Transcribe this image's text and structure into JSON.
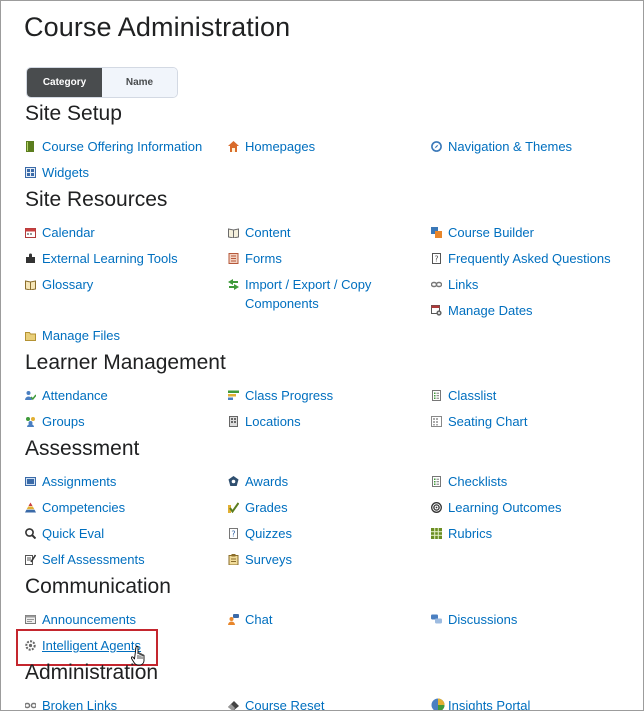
{
  "page": {
    "title": "Course Administration"
  },
  "view_toggle": {
    "category_label": "Category",
    "name_label": "Name",
    "selected": "Category"
  },
  "sections": [
    {
      "heading": "Site Setup",
      "tools": [
        {
          "label": "Course Offering Information",
          "icon": "book-icon"
        },
        {
          "label": "Homepages",
          "icon": "home-icon"
        },
        {
          "label": "Navigation & Themes",
          "icon": "compass-icon"
        },
        {
          "label": "Widgets",
          "icon": "widget-grid-icon"
        }
      ]
    },
    {
      "heading": "Site Resources",
      "tools": [
        {
          "label": "Calendar",
          "icon": "calendar-icon"
        },
        {
          "label": "Content",
          "icon": "open-book-icon"
        },
        {
          "label": "Course Builder",
          "icon": "course-builder-icon"
        },
        {
          "label": "External Learning Tools",
          "icon": "puzzle-icon"
        },
        {
          "label": "Forms",
          "icon": "forms-icon"
        },
        {
          "label": "Frequently Asked Questions",
          "icon": "faq-icon"
        },
        {
          "label": "Glossary",
          "icon": "glossary-book-icon"
        },
        {
          "label": "Import / Export / Copy Components",
          "icon": "import-export-icon"
        },
        {
          "label": "Links",
          "icon": "chain-link-icon"
        },
        {
          "label": "Manage Dates",
          "icon": "date-gear-icon"
        },
        {
          "label": "Manage Files",
          "icon": "folder-icon"
        }
      ]
    },
    {
      "heading": "Learner Management",
      "tools": [
        {
          "label": "Attendance",
          "icon": "attendance-icon"
        },
        {
          "label": "Class Progress",
          "icon": "progress-bars-icon"
        },
        {
          "label": "Classlist",
          "icon": "list-icon"
        },
        {
          "label": "Groups",
          "icon": "groups-icon"
        },
        {
          "label": "Locations",
          "icon": "building-icon"
        },
        {
          "label": "Seating Chart",
          "icon": "seating-chart-icon"
        }
      ]
    },
    {
      "heading": "Assessment",
      "tools": [
        {
          "label": "Assignments",
          "icon": "assignment-box-icon"
        },
        {
          "label": "Awards",
          "icon": "award-badge-icon"
        },
        {
          "label": "Checklists",
          "icon": "checklist-icon"
        },
        {
          "label": "Competencies",
          "icon": "pyramid-icon"
        },
        {
          "label": "Grades",
          "icon": "grades-check-icon"
        },
        {
          "label": "Learning Outcomes",
          "icon": "target-spiral-icon"
        },
        {
          "label": "Quick Eval",
          "icon": "quick-eval-icon"
        },
        {
          "label": "Quizzes",
          "icon": "quiz-icon"
        },
        {
          "label": "Rubrics",
          "icon": "rubric-grid-icon"
        },
        {
          "label": "Self Assessments",
          "icon": "self-assessment-icon"
        },
        {
          "label": "Surveys",
          "icon": "clipboard-icon"
        }
      ]
    },
    {
      "heading": "Communication",
      "tools": [
        {
          "label": "Announcements",
          "icon": "announcement-icon"
        },
        {
          "label": "Chat",
          "icon": "chat-person-icon"
        },
        {
          "label": "Discussions",
          "icon": "discussion-bubbles-icon"
        },
        {
          "label": "Intelligent Agents",
          "icon": "agent-gear-icon"
        }
      ]
    },
    {
      "heading": "Administration",
      "tools": [
        {
          "label": "Broken Links",
          "icon": "broken-link-icon"
        },
        {
          "label": "Course Reset",
          "icon": "eraser-icon"
        },
        {
          "label": "Insights Portal",
          "icon": "pie-chart-icon"
        }
      ]
    }
  ],
  "colors": {
    "link": "#006fbf",
    "heading": "#202122",
    "toggle_active_bg": "#494c4e",
    "toggle_inactive_bg": "#f1f5fb",
    "highlight": "#c4262e"
  }
}
